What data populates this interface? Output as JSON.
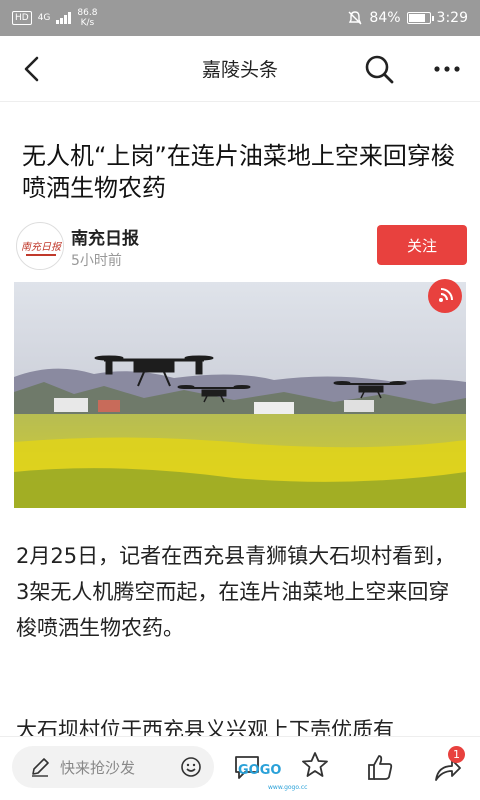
{
  "status_bar": {
    "badge": "HD",
    "network": "4G",
    "speed_value": "86.8",
    "speed_unit": "K/s",
    "battery_text": "84%",
    "battery_level": 0.84,
    "time": "3:29"
  },
  "header": {
    "title": "嘉陵头条"
  },
  "article": {
    "title": "无人机“上岗”在连片油菜地上空来回穿梭喷洒生物农药",
    "source_name": "南充日报",
    "source_time": "5小时前",
    "follow_label": "关注",
    "logo_text": "南充日报",
    "paragraph1": "2月25日，记者在西充县青狮镇大石坝村看到，3架无人机腾空而起，在连片油菜地上空来回穿梭喷洒生物农药。",
    "paragraph2": "大石坝村位于西充县义兴观上下壳优质有"
  },
  "bottom_bar": {
    "comment_placeholder": "快来抢沙发",
    "share_badge": "1",
    "watermark": "GOGO",
    "watermark_sub": "www.gogo.cc"
  },
  "colors": {
    "accent": "#e8413e",
    "status_bar": "#9a9a9a"
  }
}
